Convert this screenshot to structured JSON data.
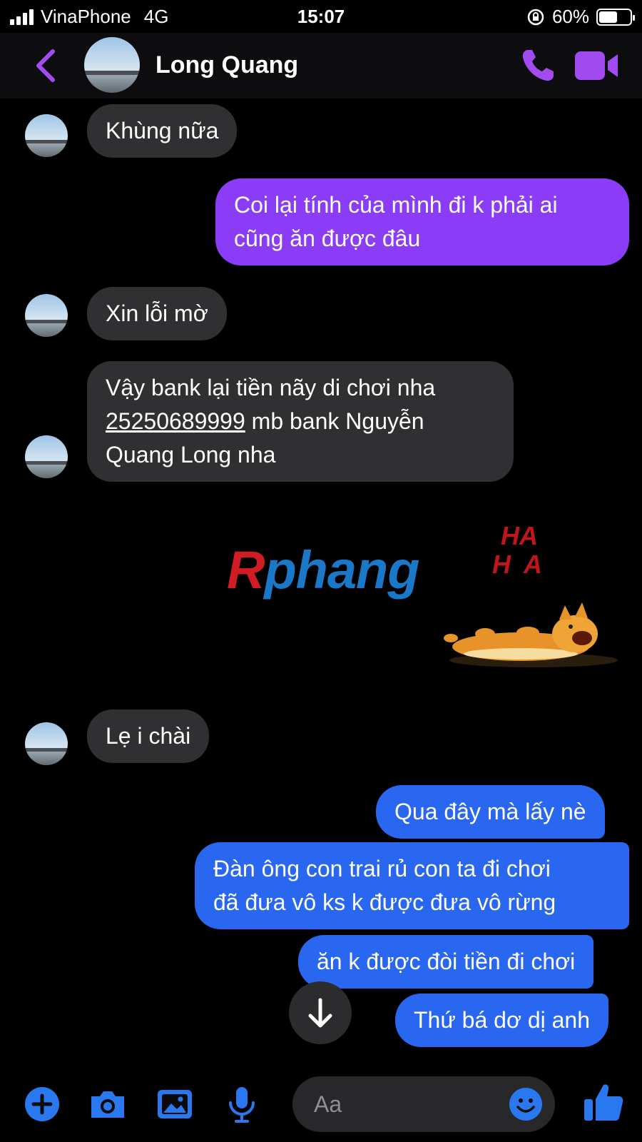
{
  "status_bar": {
    "carrier": "VinaPhone",
    "network": "4G",
    "time": "15:07",
    "battery": "60%",
    "battery_level": 0.6
  },
  "header": {
    "contact_name": "Long Quang",
    "icons": [
      "back-chevron-icon",
      "avatar",
      "phone-icon",
      "video-camera-icon"
    ],
    "accent_color": "#a24bf0"
  },
  "messages": [
    {
      "side": "in",
      "text": "Khùng nữa"
    },
    {
      "side": "out",
      "color": "#8a3cf6",
      "lines": [
        "Coi lại tính của mình đi k phải ai",
        "cũng ăn được đâu"
      ]
    },
    {
      "side": "in",
      "text": "Xin lỗi mờ"
    },
    {
      "side": "in",
      "lines": [
        "Vậy bank lại tiền nãy di chơi nha"
      ],
      "account_number": "25250689999",
      "account_suffix": " mb bank Nguyễn",
      "last_line": "Quang Long nha"
    },
    {
      "side": "in",
      "type": "sticker",
      "sticker_text": [
        "HA",
        "HA"
      ]
    },
    {
      "side": "in",
      "text": "Lẹ i chài"
    },
    {
      "side": "out",
      "color": "#2a67f0",
      "text": "Qua đây mà lấy nè"
    },
    {
      "side": "out",
      "color": "#2a67f0",
      "lines": [
        "Đàn ông con trai rủ con ta đi chơi",
        "đã đưa vô ks k được đưa vô rừng"
      ]
    },
    {
      "side": "out",
      "color": "#2a67f0",
      "text": "ăn k được đòi tiền đi chơi"
    },
    {
      "side": "out",
      "color": "#2a67f0",
      "text": "Thứ bá dơ dị anh"
    }
  ],
  "watermark": {
    "first": "R",
    "rest": "phang"
  },
  "composer": {
    "placeholder": "Aa",
    "tools": [
      "plus-icon",
      "camera-icon",
      "image-icon",
      "microphone-icon",
      "emoji-icon",
      "thumbs-up-icon"
    ],
    "accent_color": "#2a78f0"
  }
}
